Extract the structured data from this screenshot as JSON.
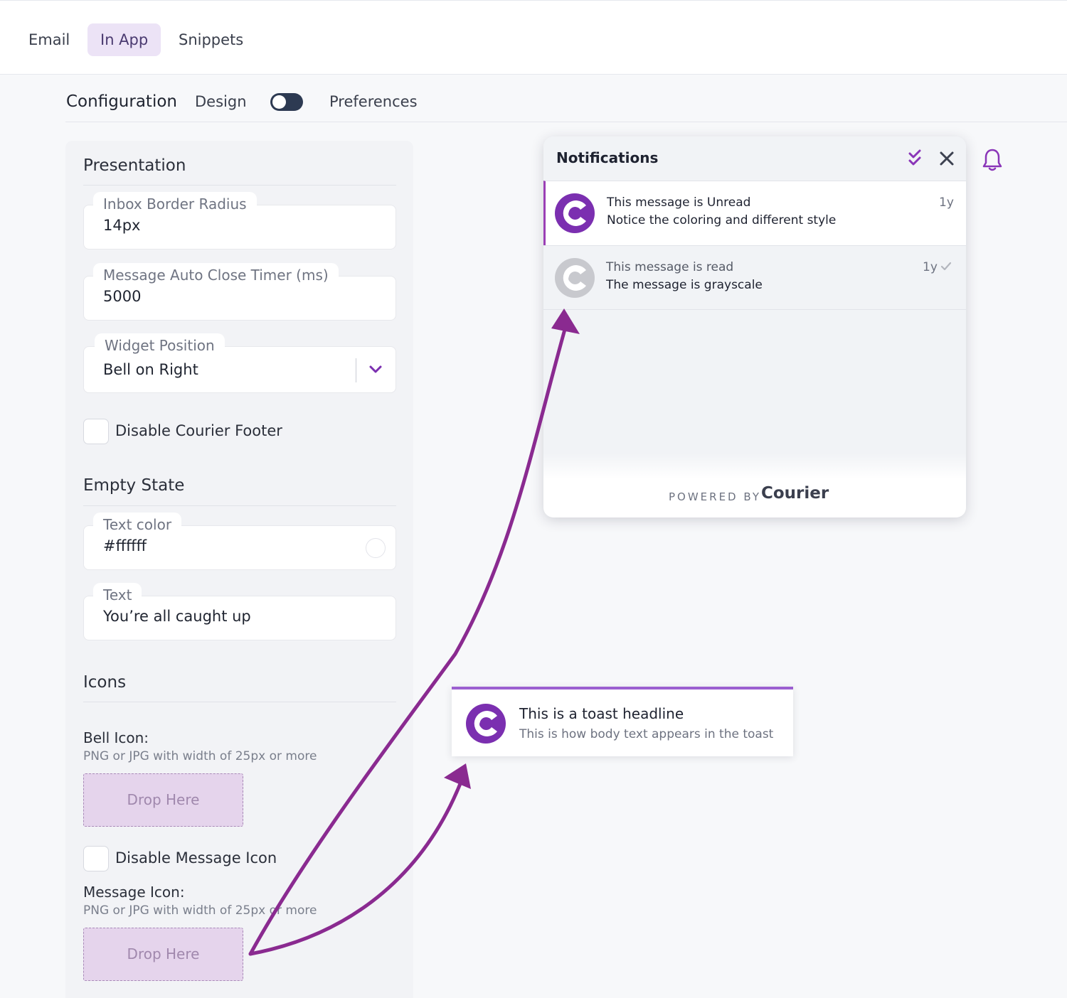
{
  "top_tabs": [
    {
      "label": "Email"
    },
    {
      "label": "In App"
    },
    {
      "label": "Snippets"
    }
  ],
  "subnav": {
    "configuration": "Configuration",
    "design": "Design",
    "preferences": "Preferences",
    "toggle_on": false
  },
  "presentation": {
    "title": "Presentation",
    "border_radius": {
      "label": "Inbox Border Radius",
      "value": "14px"
    },
    "auto_close": {
      "label": "Message Auto Close Timer (ms)",
      "value": "5000"
    },
    "widget_position": {
      "label": "Widget Position",
      "value": "Bell on Right"
    },
    "disable_footer": {
      "label": "Disable Courier Footer",
      "checked": false
    }
  },
  "empty_state": {
    "title": "Empty State",
    "text_color": {
      "label": "Text color",
      "value": "#ffffff"
    },
    "text": {
      "label": "Text",
      "value": "You’re all caught up"
    }
  },
  "icons": {
    "title": "Icons",
    "bell_icon": {
      "title": "Bell Icon:",
      "hint": "PNG or JPG with width of 25px or more",
      "drop": "Drop Here"
    },
    "disable_message_icon": {
      "label": "Disable Message Icon",
      "checked": false
    },
    "message_icon": {
      "title": "Message Icon:",
      "hint": "PNG or JPG with width of 25px or more",
      "drop": "Drop Here"
    }
  },
  "notifications": {
    "title": "Notifications",
    "items": [
      {
        "title": "This message is Unread",
        "body": "Notice the coloring and different style",
        "time": "1y",
        "read": false
      },
      {
        "title": "This message is read",
        "body": "The message is grayscale",
        "time": "1y",
        "read": true
      }
    ],
    "powered_by": "POWERED BY",
    "brand": "Courier"
  },
  "toast": {
    "title": "This is a toast headline",
    "body": "This is how body text appears in the toast"
  },
  "colors": {
    "accent": "#7b2fb0",
    "toast_border": "#9b5fd0",
    "tab_active_bg": "#ece3f6",
    "annotation_arrow": "#8a2a90"
  }
}
